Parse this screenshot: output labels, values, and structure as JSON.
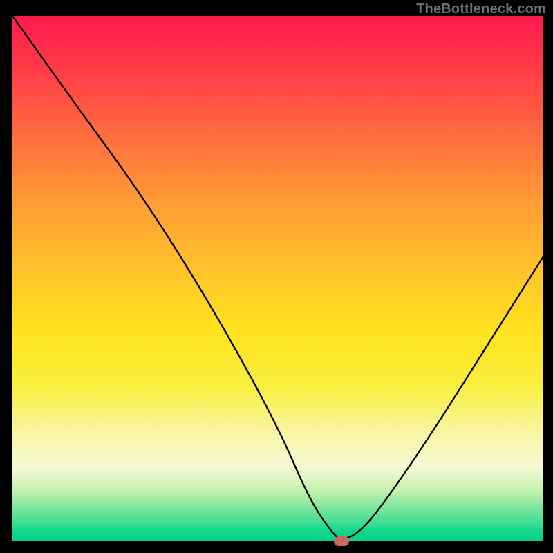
{
  "attribution": "TheBottleneck.com",
  "chart_data": {
    "type": "line",
    "title": "",
    "xlabel": "",
    "ylabel": "",
    "xlim": [
      0,
      100
    ],
    "ylim": [
      0,
      100
    ],
    "x": [
      0,
      12,
      25,
      38,
      50,
      56,
      60,
      62,
      66,
      72,
      80,
      90,
      100
    ],
    "values": [
      100,
      83,
      65,
      44,
      22,
      8,
      2,
      0,
      2,
      10,
      22,
      38,
      54
    ],
    "marker": {
      "x": 62,
      "y": 0
    },
    "gradient_zones": [
      "red",
      "orange",
      "yellow",
      "pale-yellow",
      "green"
    ]
  },
  "colors": {
    "frame": "#000000",
    "marker": "#cb6a62",
    "attribution": "#6f6f6f"
  }
}
